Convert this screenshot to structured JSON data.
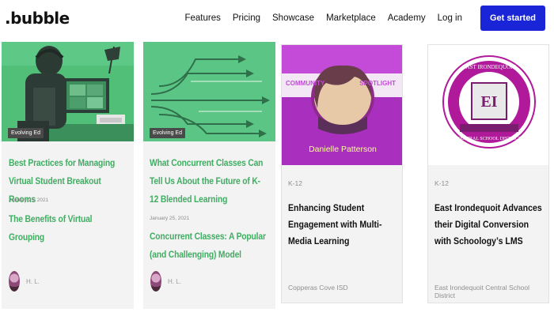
{
  "nav": {
    "logo": ".bubble",
    "links": [
      "Features",
      "Pricing",
      "Showcase",
      "Marketplace",
      "Academy",
      "Log in"
    ],
    "cta": "Get started"
  },
  "cards": [
    {
      "tag": "Evolving Ed",
      "title": "Best Practices for Managing Virtual Student Breakout Rooms",
      "date": "January 25, 2021",
      "subtitle": "The Benefits of Virtual Grouping",
      "author": "H. L."
    },
    {
      "tag": "Evolving Ed",
      "title": "What Concurrent Classes Can Tell Us About the Future of K-12 Blended Learning",
      "date": "January 25, 2021",
      "subtitle": "Concurrent Classes: A Popular (and Challenging) Model",
      "author": "H. L."
    },
    {
      "banner_left": "COMMUNITY",
      "banner_right": "SPOTLIGHT",
      "person_name": "Danielle Patterson",
      "category": "K-12",
      "title": "Enhancing Student Engagement with Multi-Media Learning",
      "source": "Copperas Cove ISD"
    },
    {
      "category": "K-12",
      "title": "East Irondequoit Advances their Digital Conversion with Schoology’s LMS",
      "source": "East Irondequoit Central School District",
      "seal_top": "EAST IRONDEQUOIT",
      "seal_letters": "EI",
      "seal_bottom": "CENTRAL SCHOOL DISTRICT"
    }
  ],
  "colors": {
    "accent_green": "#3fae62",
    "cta_blue": "#1a25d8",
    "spotlight_magenta": "#b53bc9"
  }
}
